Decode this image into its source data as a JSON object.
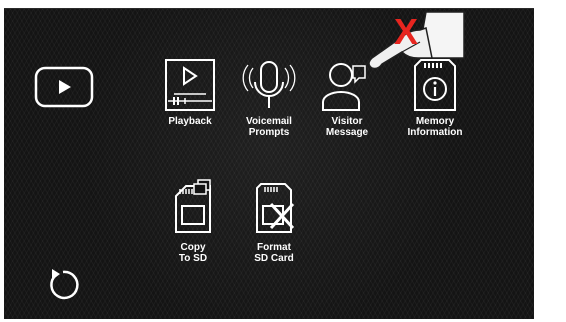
{
  "menu": {
    "playback": {
      "label": "Playback",
      "icon": "playback-icon"
    },
    "voicemail": {
      "label": "Voicemail\nPrompts",
      "icon": "microphone-icon"
    },
    "visitor": {
      "label": "Visitor\nMessage",
      "icon": "visitor-icon"
    },
    "memory": {
      "label": "Memory\nInformation",
      "icon": "sd-info-icon"
    },
    "copy": {
      "label": "Copy\nTo SD",
      "icon": "copy-to-sd-icon"
    },
    "format": {
      "label": "Format\nSD Card",
      "icon": "format-sd-icon"
    }
  },
  "side": {
    "video_button": {
      "icon": "video-play-icon"
    },
    "back_button": {
      "icon": "refresh-back-icon"
    }
  },
  "overlay": {
    "mark": "X",
    "mark_color": "#e8251f",
    "icon": "pointing-hand-icon"
  },
  "colors": {
    "background": "#141414",
    "icon": "#ffffff",
    "text": "#ffffff"
  }
}
